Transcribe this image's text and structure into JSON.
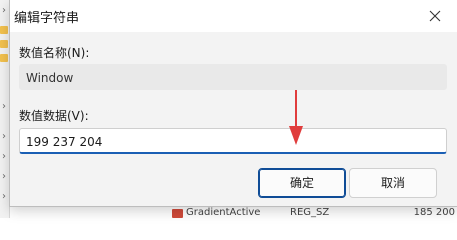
{
  "dialog": {
    "title": "编辑字符串",
    "name_label": "数值名称(N):",
    "name_value": "Window",
    "data_label": "数值数据(V):",
    "data_value": "199 237 204",
    "ok_label": "确定",
    "cancel_label": "取消"
  },
  "background": {
    "partial_value_name": "GradientActive",
    "partial_value_type": "REG_SZ",
    "partial_value_data": "185 200"
  },
  "colors": {
    "accent": "#1a5fb4",
    "arrow": "#e03c3c",
    "dialog_bg": "#f3f3f3"
  }
}
